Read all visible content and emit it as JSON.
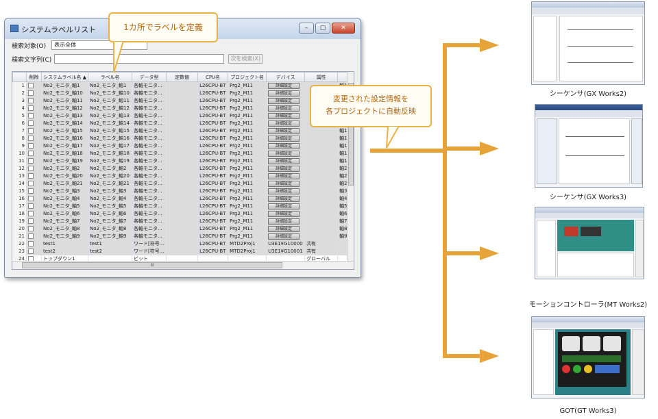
{
  "window": {
    "title": "システムラベルリスト",
    "buttons": [
      "–",
      "▢",
      "✕"
    ],
    "search_target_label": "検索対象(O)",
    "search_target_value": "表示全体",
    "search_text_label": "検索文字列(C)",
    "search_text_value": "",
    "find_next_label": "次を検索(X)"
  },
  "table": {
    "columns": [
      "",
      "削除",
      "システムラベル名 ▲",
      "ラベル名",
      "データ型",
      "定数値",
      "CPU名",
      "プロジェクト名",
      "デバイス",
      "属性"
    ],
    "rows": [
      {
        "n": "1",
        "sys": "No2_モニタ_軸1",
        "label": "No2_モニタ_軸1",
        "type": "各軸モニタ...",
        "cpu": "L26CPU-BT",
        "proj": "Prg2_M11",
        "dev": "詳細設定",
        "attr": "",
        "extra": "軸1",
        "gray": true
      },
      {
        "n": "2",
        "sys": "No2_モニタ_軸10",
        "label": "No2_モニタ_軸10",
        "type": "各軸モニタ...",
        "cpu": "L26CPU-BT",
        "proj": "Prg2_M11",
        "dev": "詳細設定",
        "attr": "",
        "extra": "",
        "gray": true
      },
      {
        "n": "3",
        "sys": "No2_モニタ_軸11",
        "label": "No2_モニタ_軸11",
        "type": "各軸モニタ...",
        "cpu": "L26CPU-BT",
        "proj": "Prg2_M11",
        "dev": "詳細設定",
        "attr": "",
        "extra": "",
        "gray": true
      },
      {
        "n": "4",
        "sys": "No2_モニタ_軸12",
        "label": "No2_モニタ_軸12",
        "type": "各軸モニタ...",
        "cpu": "L26CPU-BT",
        "proj": "Prg2_M11",
        "dev": "詳細設定",
        "attr": "",
        "extra": "",
        "gray": true
      },
      {
        "n": "5",
        "sys": "No2_モニタ_軸13",
        "label": "No2_モニタ_軸13",
        "type": "各軸モニタ...",
        "cpu": "L26CPU-BT",
        "proj": "Prg2_M11",
        "dev": "詳細設定",
        "attr": "",
        "extra": "",
        "gray": true
      },
      {
        "n": "6",
        "sys": "No2_モニタ_軸14",
        "label": "No2_モニタ_軸14",
        "type": "各軸モニタ...",
        "cpu": "L26CPU-BT",
        "proj": "Prg2_M11",
        "dev": "詳細設定",
        "attr": "",
        "extra": "",
        "gray": true
      },
      {
        "n": "7",
        "sys": "No2_モニタ_軸15",
        "label": "No2_モニタ_軸15",
        "type": "各軸モニタ...",
        "cpu": "L26CPU-BT",
        "proj": "Prg2_M11",
        "dev": "詳細設定",
        "attr": "",
        "extra": "軸1",
        "gray": true
      },
      {
        "n": "8",
        "sys": "No2_モニタ_軸16",
        "label": "No2_モニタ_軸16",
        "type": "各軸モニタ...",
        "cpu": "L26CPU-BT",
        "proj": "Prg2_M11",
        "dev": "詳細設定",
        "attr": "",
        "extra": "軸1",
        "gray": true
      },
      {
        "n": "9",
        "sys": "No2_モニタ_軸17",
        "label": "No2_モニタ_軸17",
        "type": "各軸モニタ...",
        "cpu": "L26CPU-BT",
        "proj": "Prg2_M11",
        "dev": "詳細設定",
        "attr": "",
        "extra": "軸1",
        "gray": true
      },
      {
        "n": "10",
        "sys": "No2_モニタ_軸18",
        "label": "No2_モニタ_軸18",
        "type": "各軸モニタ...",
        "cpu": "L26CPU-BT",
        "proj": "Prg2_M11",
        "dev": "詳細設定",
        "attr": "",
        "extra": "軸1",
        "gray": true
      },
      {
        "n": "11",
        "sys": "No2_モニタ_軸19",
        "label": "No2_モニタ_軸19",
        "type": "各軸モニタ...",
        "cpu": "L26CPU-BT",
        "proj": "Prg2_M11",
        "dev": "詳細設定",
        "attr": "",
        "extra": "軸1",
        "gray": true
      },
      {
        "n": "12",
        "sys": "No2_モニタ_軸2",
        "label": "No2_モニタ_軸2",
        "type": "各軸モニタ...",
        "cpu": "L26CPU-BT",
        "proj": "Prg2_M11",
        "dev": "詳細設定",
        "attr": "",
        "extra": "軸2",
        "gray": true
      },
      {
        "n": "13",
        "sys": "No2_モニタ_軸20",
        "label": "No2_モニタ_軸20",
        "type": "各軸モニタ...",
        "cpu": "L26CPU-BT",
        "proj": "Prg2_M11",
        "dev": "詳細設定",
        "attr": "",
        "extra": "軸2",
        "gray": true
      },
      {
        "n": "14",
        "sys": "No2_モニタ_軸21",
        "label": "No2_モニタ_軸21",
        "type": "各軸モニタ...",
        "cpu": "L26CPU-BT",
        "proj": "Prg2_M11",
        "dev": "詳細設定",
        "attr": "",
        "extra": "軸2",
        "gray": true
      },
      {
        "n": "15",
        "sys": "No2_モニタ_軸3",
        "label": "No2_モニタ_軸3",
        "type": "各軸モニタ...",
        "cpu": "L26CPU-BT",
        "proj": "Prg2_M11",
        "dev": "詳細設定",
        "attr": "",
        "extra": "軸3",
        "gray": true
      },
      {
        "n": "16",
        "sys": "No2_モニタ_軸4",
        "label": "No2_モニタ_軸4",
        "type": "各軸モニタ...",
        "cpu": "L26CPU-BT",
        "proj": "Prg2_M11",
        "dev": "詳細設定",
        "attr": "",
        "extra": "軸4",
        "gray": true
      },
      {
        "n": "17",
        "sys": "No2_モニタ_軸5",
        "label": "No2_モニタ_軸5",
        "type": "各軸モニタ...",
        "cpu": "L26CPU-BT",
        "proj": "Prg2_M11",
        "dev": "詳細設定",
        "attr": "",
        "extra": "軸5",
        "gray": true
      },
      {
        "n": "18",
        "sys": "No2_モニタ_軸6",
        "label": "No2_モニタ_軸6",
        "type": "各軸モニタ...",
        "cpu": "L26CPU-BT",
        "proj": "Prg2_M11",
        "dev": "詳細設定",
        "attr": "",
        "extra": "軸6",
        "gray": true
      },
      {
        "n": "19",
        "sys": "No2_モニタ_軸7",
        "label": "No2_モニタ_軸7",
        "type": "各軸モニタ...",
        "cpu": "L26CPU-BT",
        "proj": "Prg2_M11",
        "dev": "詳細設定",
        "attr": "",
        "extra": "軸7",
        "gray": true
      },
      {
        "n": "20",
        "sys": "No2_モニタ_軸8",
        "label": "No2_モニタ_軸8",
        "type": "各軸モニタ...",
        "cpu": "L26CPU-BT",
        "proj": "Prg2_M11",
        "dev": "詳細設定",
        "attr": "",
        "extra": "軸8",
        "gray": true
      },
      {
        "n": "21",
        "sys": "No2_モニタ_軸9",
        "label": "No2_モニタ_軸9",
        "type": "各軸モニタ...",
        "cpu": "L26CPU-BT",
        "proj": "Prg2_M11",
        "dev": "詳細設定",
        "attr": "",
        "extra": "軸9",
        "gray": true
      },
      {
        "n": "22",
        "sys": "test1",
        "label": "test1",
        "type": "ワード[符号...",
        "cpu": "L26CPU-BT",
        "proj": "MTD2Proj1",
        "dev": "U3E1¥G10000",
        "attr": "共有",
        "extra": "",
        "gray": true
      },
      {
        "n": "23",
        "sys": "test2",
        "label": "test2",
        "type": "ワード[符号...",
        "cpu": "L26CPU-BT",
        "proj": "MTD2Proj1",
        "dev": "U3E1¥G10001",
        "attr": "共有",
        "extra": "",
        "gray": true
      },
      {
        "n": "24",
        "sys": "トップダウン1",
        "label": "",
        "type": "ビット",
        "cpu": "",
        "proj": "",
        "dev": "",
        "attr": "グローバル",
        "extra": "",
        "gray": false
      }
    ],
    "hscroll_label": "III"
  },
  "callouts": {
    "define": "1カ所でラベルを定義",
    "reflect_line1": "変更された設定情報を",
    "reflect_line2": "各プロジェクトに自動反映"
  },
  "targets": [
    {
      "caption": "シーケンサ(GX Works2)"
    },
    {
      "caption": "シーケンサ(GX Works3)"
    },
    {
      "caption": "モーションコントローラ(MT Works2)"
    },
    {
      "caption": "GOT(GT Works3)"
    }
  ],
  "colors": {
    "arrow": "#e6a33a",
    "callout_border": "#e9b244",
    "callout_text": "#b3670a"
  }
}
